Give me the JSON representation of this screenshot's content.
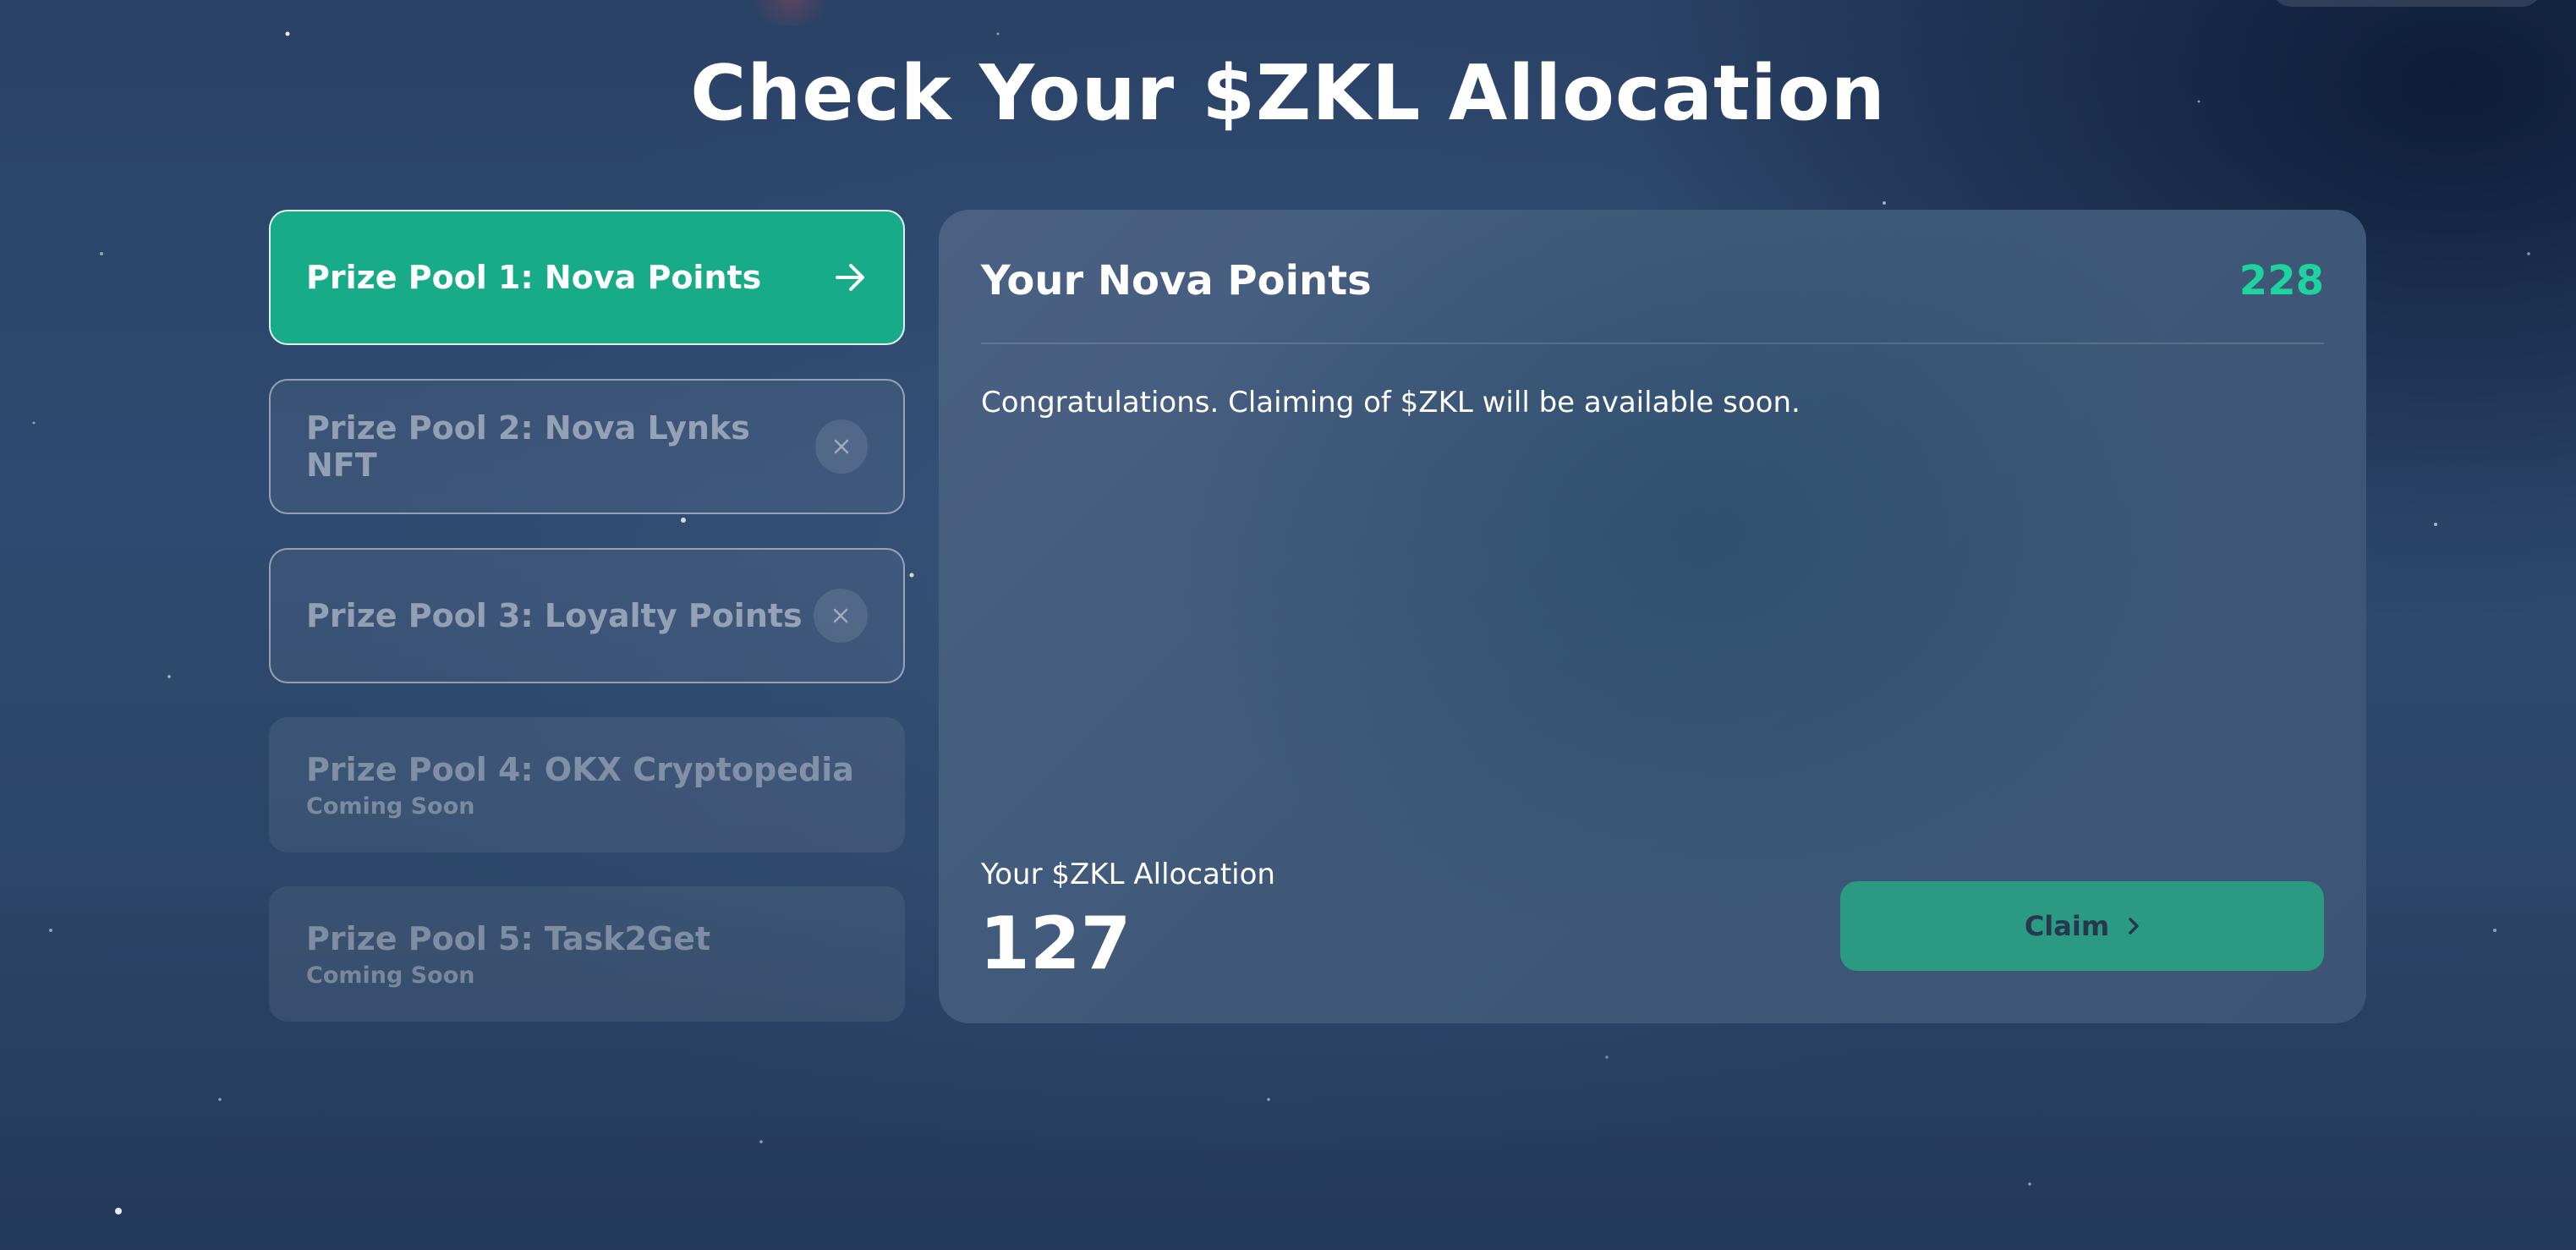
{
  "page": {
    "title": "Check Your $ZKL Allocation"
  },
  "pools": [
    {
      "label": "Prize Pool 1: Nova Points",
      "state": "active",
      "icon": "arrow-right-icon"
    },
    {
      "label": "Prize Pool 2: Nova Lynks NFT",
      "state": "unavailable",
      "icon": "close-icon"
    },
    {
      "label": "Prize Pool 3: Loyalty Points",
      "state": "unavailable",
      "icon": "close-icon"
    },
    {
      "label": "Prize Pool 4: OKX Cryptopedia",
      "status": "Coming Soon",
      "state": "coming-soon"
    },
    {
      "label": "Prize Pool 5: Task2Get",
      "status": "Coming Soon",
      "state": "coming-soon"
    }
  ],
  "panel": {
    "title": "Your Nova Points",
    "points": "228",
    "message": "Congratulations. Claiming of $ZKL will be available soon.",
    "allocation_label": "Your $ZKL Allocation",
    "allocation_value": "127",
    "claim_label": "Claim"
  },
  "colors": {
    "accent": "#17ab88",
    "points": "#1fd3a0",
    "claim_bg": "#2a9a82"
  }
}
